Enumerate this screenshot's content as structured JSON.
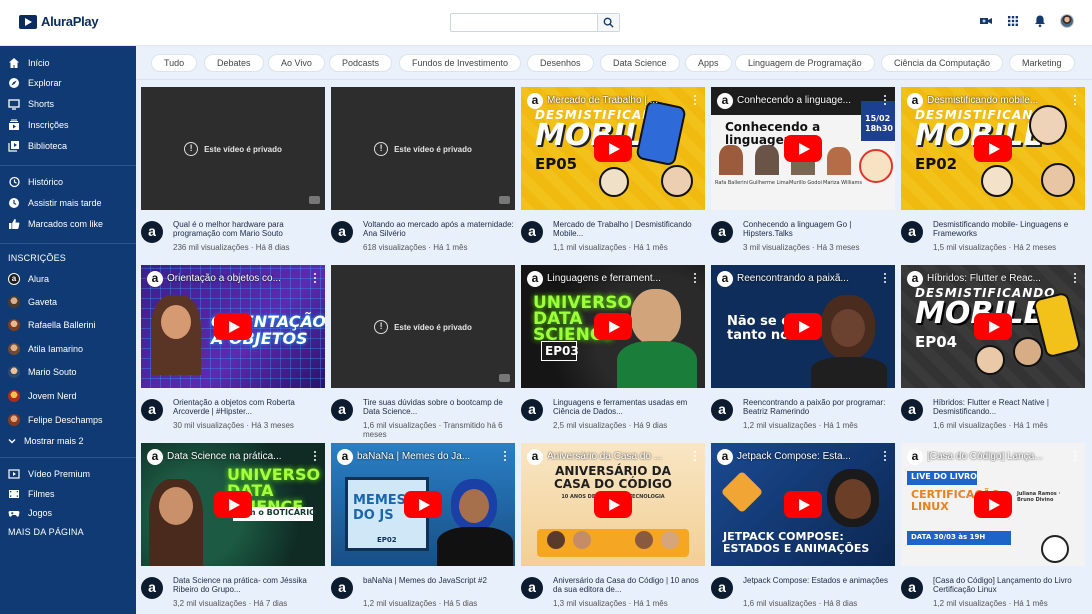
{
  "app": {
    "logo_text": "AluraPlay",
    "search": {
      "placeholder": "",
      "value": ""
    }
  },
  "sidebar": {
    "main": [
      {
        "label": "Início",
        "icon": "home-icon"
      },
      {
        "label": "Explorar",
        "icon": "compass-icon"
      },
      {
        "label": "Shorts",
        "icon": "shorts-icon"
      },
      {
        "label": "Inscrições",
        "icon": "subscriptions-icon"
      },
      {
        "label": "Biblioteca",
        "icon": "library-icon"
      }
    ],
    "library": [
      {
        "label": "Histórico",
        "icon": "history-icon"
      },
      {
        "label": "Assistir mais tarde",
        "icon": "clock-icon"
      },
      {
        "label": "Marcados com like",
        "icon": "thumbs-up-icon"
      }
    ],
    "subscriptions_heading": "INSCRIÇÕES",
    "subscriptions": [
      {
        "label": "Alura",
        "color": "#1b1b1b"
      },
      {
        "label": "Gaveta",
        "color": "#6b5a49"
      },
      {
        "label": "Rafaella Ballerini",
        "color": "#b87a5c"
      },
      {
        "label": "Atila Iamarino",
        "color": "#8f6b50"
      },
      {
        "label": "Mario Souto",
        "color": "#c49a6c"
      },
      {
        "label": "Jovem Nerd",
        "color": "#d9a521"
      },
      {
        "label": "Felipe Deschamps",
        "color": "#b5643f"
      }
    ],
    "show_more": "Mostrar mais 2",
    "more": [
      {
        "label": "Vídeo Premium",
        "icon": "premium-icon"
      },
      {
        "label": "Filmes",
        "icon": "film-icon"
      },
      {
        "label": "Jogos",
        "icon": "gamepad-icon"
      }
    ],
    "more_heading": "MAIS DA PÁGINA"
  },
  "chips": [
    "Tudo",
    "Debates",
    "Ao Vivo",
    "Podcasts",
    "Fundos de Investimento",
    "Desenhos",
    "Data Science",
    "Apps",
    "Linguagem de Programação",
    "Ciência da Computação",
    "Marketing"
  ],
  "private_label": "Este vídeo é privado",
  "videos": [
    {
      "private": true,
      "title": "Qual é o melhor hardware para programação com Mario Souto",
      "stats": "236 mil visualizações · Há 8 dias"
    },
    {
      "private": true,
      "title": "Voltando ao mercado após a maternidade: Ana Silvério",
      "stats": "618 visualizações · Há 1 mês"
    },
    {
      "private": false,
      "thumb_title": "Mercado de Trabalho | ...",
      "big": "MOBILE",
      "sub": "EP05",
      "top": "DESMISTIFICANDO",
      "bg": "#f2c21b",
      "title": "Mercado de Trabalho | Desmistificando Mobile...",
      "stats": "1,1 mil visualizações · Há 1 mês"
    },
    {
      "private": false,
      "thumb_title": "Conhecendo a linguage...",
      "big": "Conhecendo a linguagem Go",
      "date": "15/02",
      "time": "18h30",
      "people": [
        "Rafa Ballerini",
        "Guilherme Lima",
        "Murillo Godoi",
        "Mariza Williams"
      ],
      "bg": "#f4f4f4",
      "title": "Conhecendo a linguagem Go | Hipsters.Talks",
      "stats": "3 mil visualizações · Há 3 meses"
    },
    {
      "private": false,
      "thumb_title": "Desmistificando mobile...",
      "big": "MOBILE",
      "sub": "EP02",
      "top": "DESMISTIFICANDO",
      "bg": "#f2c21b",
      "title": "Desmistificando mobile- Linguagens e Frameworks",
      "stats": "1,5 mil visualizações · Há 2 meses"
    },
    {
      "private": false,
      "thumb_title": "Orientação a objetos co...",
      "big": "ORIENTAÇÃO A OBJETOS",
      "bg": "#3a1f8a",
      "title": "Orientação a objetos com Roberta Arcoverde | #Hipster...",
      "stats": "30 mil visualizações · Há 3 meses"
    },
    {
      "private": true,
      "title": "Tire suas dúvidas sobre o bootcamp de Data Science...",
      "stats": "1,6 mil visualizações · Transmitido há 6 meses"
    },
    {
      "private": false,
      "thumb_title": "Linguagens e ferrament...",
      "big": "UNIVERSO DATA SCIENCE",
      "sub": "EP03",
      "bg": "#1d1d1d",
      "title": "Linguagens e ferramentas usadas em Ciência de Dados...",
      "stats": "2,5 mil visualizações · Há 9 dias"
    },
    {
      "private": false,
      "thumb_title": "Reencontrando a paixã...",
      "big": "Não se co tanto no i",
      "bg": "#0e2d5a",
      "title": "Reencontrando a paixão por programar: Beatriz Ramerindo",
      "stats": "1,2 mil visualizações · Há 1 mês"
    },
    {
      "private": false,
      "thumb_title": "Híbridos: Flutter e Reac...",
      "big": "MOBILE",
      "sub": "EP04",
      "top": "DESMISTIFICANDO",
      "bg": "#3a3a3a",
      "title": "Híbridos: Flutter e React Native | Desmistificando...",
      "stats": "1,6 mil visualizações · Há 1 mês"
    },
    {
      "private": false,
      "thumb_title": "Data Science na prática...",
      "big": "UNIVERSO DATA SCIENCE",
      "sub": "com o BOTICÁRIO",
      "bg": "#0f3a2c",
      "title": "Data Science na prática- com Jéssika Ribeiro do Grupo...",
      "stats": "3,2 mil visualizações · Há 7 dias"
    },
    {
      "private": false,
      "thumb_title": "baNaNa | Memes do Ja...",
      "big": "MEMES DO JS",
      "sub": "EP02",
      "bg": "#1f6aa8",
      "title": "baNaNa | Memes do JavaScript #2",
      "stats": "1,2 mil visualizações · Há 5 dias"
    },
    {
      "private": false,
      "thumb_title": "Aniversário da Casa do ...",
      "big": "ANIVERSÁRIO DA CASA DO CÓDIGO",
      "sub": "10 ANOS DE LIVROS DE TECNOLOGIA",
      "bg": "#f6dfb6",
      "title": "Aniversário da Casa do Código | 10 anos da sua editora de...",
      "stats": "1,3 mil visualizações · Há 1 mês"
    },
    {
      "private": false,
      "thumb_title": "Jetpack Compose: Esta...",
      "big": "JETPACK COMPOSE: ESTADOS E ANIMAÇÕES",
      "bg": "#10346a",
      "title": "Jetpack Compose: Estados e animações",
      "stats": "1,6 mil visualizações · Há 8 dias"
    },
    {
      "private": false,
      "thumb_title": "[Casa do Código] Lança...",
      "big": "CERTIFICAÇÃO LINUX",
      "sub": "DATA 30/03 às 19H",
      "top": "LIVE DO LIVRO",
      "authors": "Juliana Ramos · Bruno Divino",
      "bg": "#f3f3f3",
      "title": "[Casa do Código] Lançamento do Livro Certificação Linux",
      "stats": "1,2 mil visualizações · Há 1 mês"
    }
  ]
}
